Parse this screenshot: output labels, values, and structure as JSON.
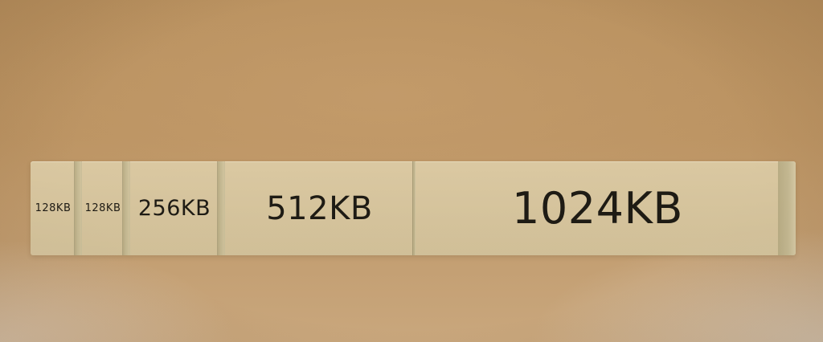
{
  "blocks": [
    {
      "label": "128KB",
      "size_kb": 128
    },
    {
      "label": "128KB",
      "size_kb": 128
    },
    {
      "label": "256KB",
      "size_kb": 256
    },
    {
      "label": "512KB",
      "size_kb": 512
    },
    {
      "label": "1024KB",
      "size_kb": 1024
    }
  ],
  "colors": {
    "background": "#bc9463",
    "strip": "#d8ccaa",
    "text": "#1e1b14"
  }
}
